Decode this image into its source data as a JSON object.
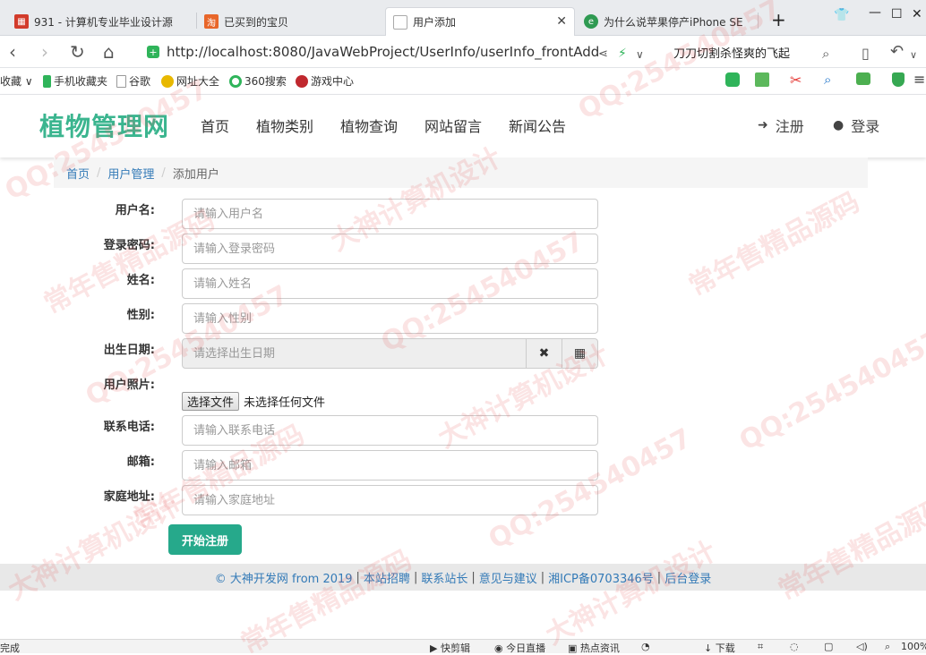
{
  "browser": {
    "tabs": [
      {
        "title": "931 - 计算机专业毕业设计源",
        "active": false
      },
      {
        "title": "已买到的宝贝",
        "active": false
      },
      {
        "title": "用户添加",
        "active": true
      },
      {
        "title": "为什么说苹果停产iPhone SE",
        "active": false
      }
    ],
    "url": "http://localhost:8080/JavaWebProject/UserInfo/userInfo_frontAdd",
    "search_text": "刀刀切割杀怪爽的飞起",
    "bookmarks": [
      "收藏",
      "手机收藏夹",
      "谷歌",
      "网址大全",
      "360搜索",
      "游戏中心"
    ],
    "status_items": [
      "完成",
      "快剪辑",
      "今日直播",
      "热点资讯",
      "下载",
      "100%"
    ]
  },
  "site": {
    "brand": "植物管理网",
    "nav": [
      "首页",
      "植物类别",
      "植物查询",
      "网站留言",
      "新闻公告"
    ],
    "register": "注册",
    "login": "登录"
  },
  "breadcrumb": {
    "home": "首页",
    "section": "用户管理",
    "current": "添加用户"
  },
  "form": {
    "username": {
      "label": "用户名:",
      "placeholder": "请输入用户名"
    },
    "password": {
      "label": "登录密码:",
      "placeholder": "请输入登录密码"
    },
    "name": {
      "label": "姓名:",
      "placeholder": "请输入姓名"
    },
    "gender": {
      "label": "性别:",
      "placeholder": "请输入性别"
    },
    "birth": {
      "label": "出生日期:",
      "placeholder": "请选择出生日期"
    },
    "photo": {
      "label": "用户照片:",
      "button": "选择文件",
      "status": "未选择任何文件"
    },
    "phone": {
      "label": "联系电话:",
      "placeholder": "请输入联系电话"
    },
    "email": {
      "label": "邮箱:",
      "placeholder": "请输入邮箱"
    },
    "address": {
      "label": "家庭地址:",
      "placeholder": "请输入家庭地址"
    },
    "submit": "开始注册"
  },
  "footer": {
    "copyright": "© 大神开发网 from 2019",
    "links": [
      "本站招聘",
      "联系站长",
      "意见与建议",
      "湘ICP备0703346号",
      "后台登录"
    ]
  },
  "watermark": {
    "lines": [
      "QQ:254540457",
      "大神计算机设计",
      "常年售精品源码"
    ]
  },
  "colors": {
    "brand": "#3bb58f",
    "submit": "#26a98b",
    "link": "#337ab7"
  }
}
